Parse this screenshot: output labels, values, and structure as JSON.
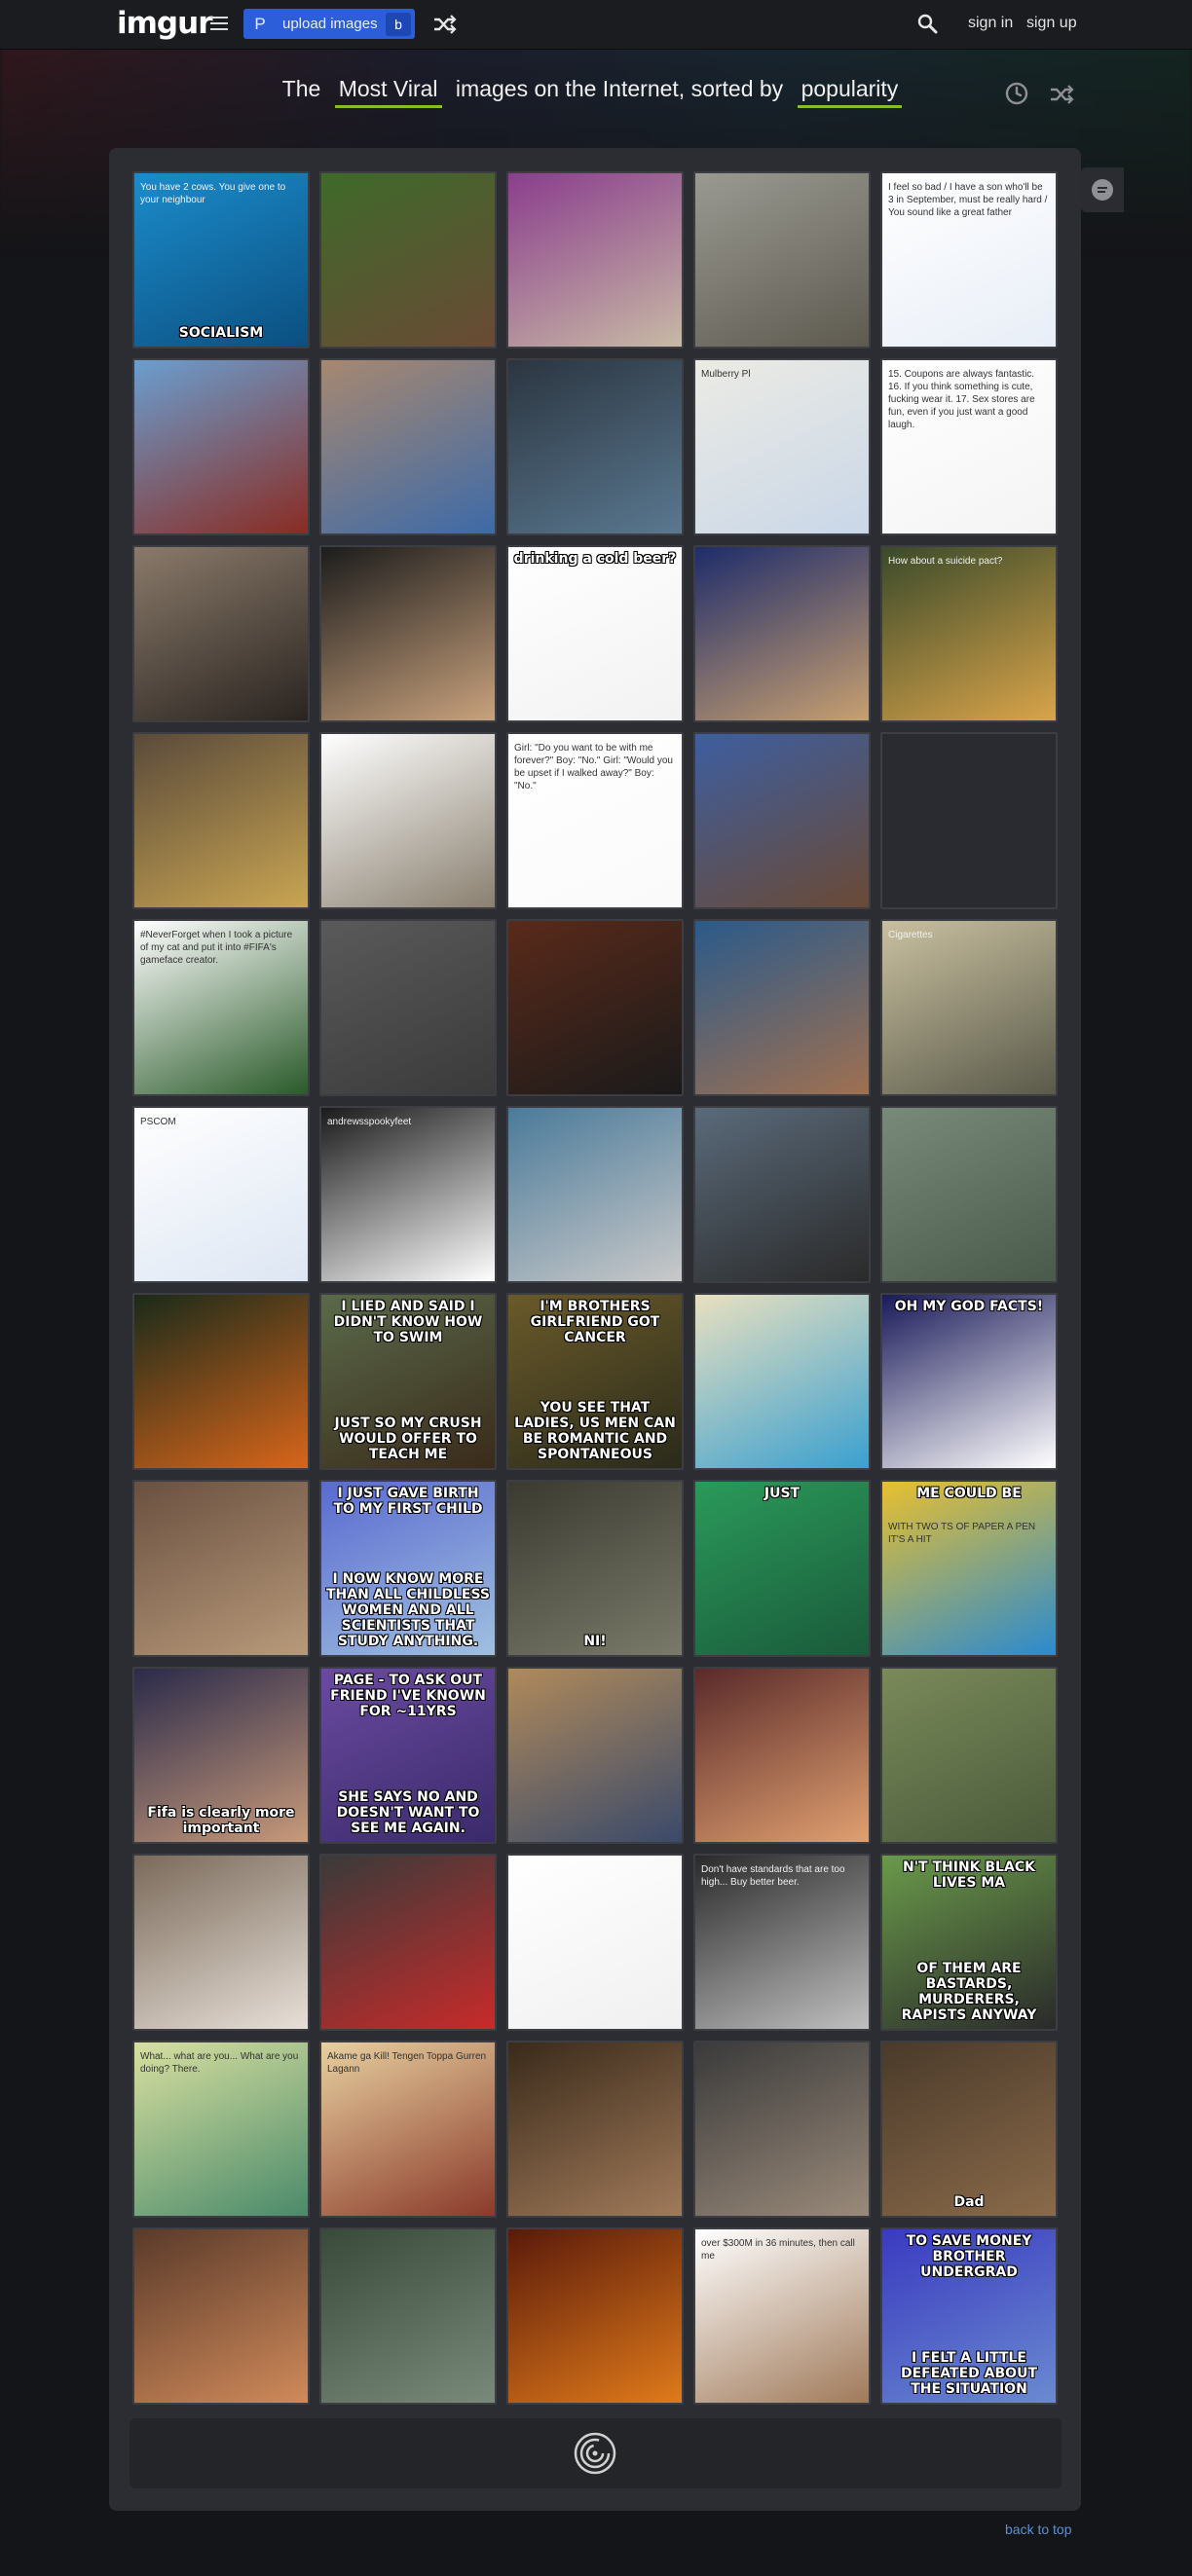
{
  "header": {
    "logo": "imgur",
    "upload_label": "upload images",
    "upload_p": "P",
    "upload_b": "b",
    "sign_in": "sign in",
    "sign_up": "sign up",
    "accent": "#2b5ed8"
  },
  "subtitle": {
    "pre": "The",
    "section": "Most Viral",
    "mid": "images on the Internet, sorted by",
    "sort": "popularity",
    "underline_color": "#85bf25"
  },
  "tiles": [
    {
      "name": "cow-socialism",
      "c1": "#1b8ccb",
      "c2": "#0b4f80",
      "cap_top": "",
      "cap_bot": "SOCIALISM",
      "note": "You have 2 cows. You give one to your neighbour"
    },
    {
      "name": "dog-hammock",
      "c1": "#3e6a2a",
      "c2": "#6a4a35",
      "cap_top": "",
      "cap_bot": "",
      "note": ""
    },
    {
      "name": "skull-flowers",
      "c1": "#8a3d8d",
      "c2": "#c8b9a5",
      "cap_top": "",
      "cap_bot": "",
      "note": ""
    },
    {
      "name": "car-field",
      "c1": "#9a9a92",
      "c2": "#5e5a50",
      "cap_top": "",
      "cap_bot": "",
      "note": ""
    },
    {
      "name": "text-conversation",
      "c1": "#ffffff",
      "c2": "#e8eef7",
      "cap_top": "",
      "cap_bot": "",
      "note": "I feel so bad / I have a son who'll be 3 in September, must be really hard / You sound like a great father"
    },
    {
      "name": "red-house",
      "c1": "#6b9ed0",
      "c2": "#8a2b22",
      "cap_top": "",
      "cap_bot": "",
      "note": ""
    },
    {
      "name": "candy-bowl",
      "c1": "#a78870",
      "c2": "#3d6aa8",
      "cap_top": "",
      "cap_bot": "",
      "note": ""
    },
    {
      "name": "software-screen",
      "c1": "#2b3540",
      "c2": "#5a7890",
      "cap_top": "",
      "cap_bot": "",
      "note": ""
    },
    {
      "name": "map-route",
      "c1": "#ecebe4",
      "c2": "#c9d7e8",
      "cap_top": "",
      "cap_bot": "",
      "note": "Mulberry Pl"
    },
    {
      "name": "list-text",
      "c1": "#ffffff",
      "c2": "#f4f4f4",
      "cap_top": "",
      "cap_bot": "",
      "note": "15. Coupons are always fantastic. 16. If you think something is cute, fucking wear it. 17. Sex stores are fun, even if you just want a good laugh."
    },
    {
      "name": "blender-cup",
      "c1": "#8a7a6a",
      "c2": "#2a2420",
      "cap_top": "",
      "cap_bot": "",
      "note": ""
    },
    {
      "name": "two-people",
      "c1": "#1c1c1c",
      "c2": "#c9a27d",
      "cap_top": "",
      "cap_bot": "",
      "note": ""
    },
    {
      "name": "cold-beer-text",
      "c1": "#ffffff",
      "c2": "#f2f2f2",
      "cap_top": "drinking a cold beer?",
      "cap_bot": "",
      "note": ""
    },
    {
      "name": "performer",
      "c1": "#1e2c6a",
      "c2": "#c8a070",
      "cap_top": "",
      "cap_bot": "",
      "note": ""
    },
    {
      "name": "animation-bee",
      "c1": "#3a4a2a",
      "c2": "#d9a44a",
      "cap_top": "",
      "cap_bot": "",
      "note": "How about a suicide pact?"
    },
    {
      "name": "r2d2-c3po",
      "c1": "#5a4a3a",
      "c2": "#c9a552",
      "cap_top": "",
      "cap_bot": "",
      "note": ""
    },
    {
      "name": "facebook-post",
      "c1": "#ffffff",
      "c2": "#8a8070",
      "cap_top": "",
      "cap_bot": "",
      "note": ""
    },
    {
      "name": "girl-boy-text",
      "c1": "#ffffff",
      "c2": "#fafafa",
      "cap_top": "",
      "cap_bot": "",
      "note": "Girl: \"Do you want to be with me forever?\" Boy: \"No.\" Girl: \"Would you be upset if I walked away?\" Boy: \"No.\""
    },
    {
      "name": "blue-blanket",
      "c1": "#3d5ea0",
      "c2": "#6a4a35",
      "cap_top": "",
      "cap_bot": "",
      "note": ""
    },
    {
      "name": "empty-dark",
      "c1": "#2a2b30",
      "c2": "#2a2b30",
      "cap_top": "",
      "cap_bot": "",
      "note": ""
    },
    {
      "name": "tweet-soccer",
      "c1": "#ffffff",
      "c2": "#2a5a2a",
      "cap_top": "",
      "cap_bot": "",
      "note": "#NeverForget when I took a picture of my cat and put it into #FIFA's gameface creator."
    },
    {
      "name": "homeless-text",
      "c1": "#5a5a5a",
      "c2": "#3a3a3a",
      "cap_top": "",
      "cap_bot": "",
      "note": ""
    },
    {
      "name": "bar-girl",
      "c1": "#5a2a1a",
      "c2": "#1a1a1a",
      "cap_top": "",
      "cap_bot": "",
      "note": ""
    },
    {
      "name": "gym-court",
      "c1": "#2a5a8a",
      "c2": "#a07050",
      "cap_top": "",
      "cap_bot": "",
      "note": ""
    },
    {
      "name": "chain-box",
      "c1": "#c9c0a0",
      "c2": "#5a5a4a",
      "cap_top": "",
      "cap_bot": "",
      "note": "Cigarettes"
    },
    {
      "name": "spreadsheet",
      "c1": "#ffffff",
      "c2": "#dde6f3",
      "cap_top": "",
      "cap_bot": "",
      "note": "PSCOM"
    },
    {
      "name": "concert-post",
      "c1": "#1a1a1a",
      "c2": "#ffffff",
      "cap_top": "",
      "cap_bot": "",
      "note": "andrewsspookyfeet"
    },
    {
      "name": "ocean-boat",
      "c1": "#4a7a9a",
      "c2": "#c9c9c9",
      "cap_top": "",
      "cap_bot": "",
      "note": ""
    },
    {
      "name": "armored-figure",
      "c1": "#5a6a7a",
      "c2": "#2a2a2a",
      "cap_top": "",
      "cap_bot": "",
      "note": ""
    },
    {
      "name": "hulk",
      "c1": "#7a8a7a",
      "c2": "#4a5a4a",
      "cap_top": "",
      "cap_bot": "",
      "note": ""
    },
    {
      "name": "playground-fire",
      "c1": "#1a2a1a",
      "c2": "#d9651a",
      "cap_top": "",
      "cap_bot": "",
      "note": ""
    },
    {
      "name": "confession-bear",
      "c1": "#5a6a4a",
      "c2": "#3a2a1a",
      "cap_top": "I LIED AND SAID I DIDN'T KNOW HOW TO SWIM",
      "cap_bot": "JUST SO MY CRUSH WOULD OFFER TO TEACH ME",
      "note": ""
    },
    {
      "name": "tiger-meme",
      "c1": "#6a5a2a",
      "c2": "#2a2a1a",
      "cap_top": "I'M BROTHERS GIRLFRIEND GOT CANCER",
      "cap_bot": "YOU SEE THAT LADIES, US MEN CAN BE ROMANTIC AND SPONTANEOUS",
      "note": ""
    },
    {
      "name": "cartoon-faces",
      "c1": "#e8e0c0",
      "c2": "#3aa0d0",
      "cap_top": "",
      "cap_bot": "",
      "note": ""
    },
    {
      "name": "god-facts",
      "c1": "#1a1a5a",
      "c2": "#ffffff",
      "cap_top": "OH MY GOD FACTS!",
      "cap_bot": "",
      "note": ""
    },
    {
      "name": "cat-room",
      "c1": "#6a5040",
      "c2": "#b89a7a",
      "cap_top": "",
      "cap_bot": "",
      "note": ""
    },
    {
      "name": "success-kid",
      "c1": "#5a6ad0",
      "c2": "#a0c0e0",
      "cap_top": "I JUST GAVE BIRTH TO MY FIRST CHILD",
      "cap_bot": "I NOW KNOW MORE THAN ALL CHILDLESS WOMEN AND ALL SCIENTISTS THAT STUDY ANYTHING.",
      "note": ""
    },
    {
      "name": "tree-cave",
      "c1": "#3a3a30",
      "c2": "#7a7a6a",
      "cap_top": "",
      "cap_bot": "NI!",
      "note": ""
    },
    {
      "name": "just-do-it",
      "c1": "#2a9a5a",
      "c2": "#1a5a3a",
      "cap_top": "JUST",
      "cap_bot": "",
      "note": ""
    },
    {
      "name": "paper-pen",
      "c1": "#e8c030",
      "c2": "#2a8ad0",
      "cap_top": "ME COULD BE",
      "cap_bot": "",
      "note": "WITH TWO TS OF PAPER A PEN IT'S A HIT"
    },
    {
      "name": "fifa-legs",
      "c1": "#2a2a4a",
      "c2": "#c89a7a",
      "cap_top": "",
      "cap_bot": "Fifa is clearly more important",
      "note": ""
    },
    {
      "name": "bad-luck-brian",
      "c1": "#6a4aa0",
      "c2": "#3a2a6a",
      "cap_top": "PAGE - TO ASK OUT FRIEND I'VE KNOWN FOR ~11YRS",
      "cap_bot": "SHE SAYS NO AND DOESN'T WANT TO SEE ME AGAIN.",
      "note": ""
    },
    {
      "name": "controllers",
      "c1": "#b08a5a",
      "c2": "#3a4a6a",
      "cap_top": "",
      "cap_bot": "",
      "note": ""
    },
    {
      "name": "dancers",
      "c1": "#5a2a2a",
      "c2": "#e0a070",
      "cap_top": "",
      "cap_bot": "",
      "note": ""
    },
    {
      "name": "park-trees",
      "c1": "#7a8a5a",
      "c2": "#4a5a3a",
      "cap_top": "",
      "cap_bot": "",
      "note": ""
    },
    {
      "name": "wedding-dance",
      "c1": "#7a6a5a",
      "c2": "#e8e0d8",
      "cap_top": "",
      "cap_bot": "",
      "note": ""
    },
    {
      "name": "speaker-cartoon",
      "c1": "#3a3a3a",
      "c2": "#c82a2a",
      "cap_top": "",
      "cap_bot": "",
      "note": ""
    },
    {
      "name": "rubiks-text",
      "c1": "#ffffff",
      "c2": "#f0f0f0",
      "cap_top": "",
      "cap_bot": "",
      "note": ""
    },
    {
      "name": "quote-man",
      "c1": "#2a2a2a",
      "c2": "#c0c0c0",
      "cap_top": "",
      "cap_bot": "",
      "note": "Don't have standards that are too high... Buy better beer."
    },
    {
      "name": "puffin",
      "c1": "#6a9a4a",
      "c2": "#2a2a2a",
      "cap_top": "N'T THINK BLACK LIVES MA",
      "cap_bot": "OF THEM ARE BASTARDS, MURDERERS, RAPISTS ANYWAY",
      "note": ""
    },
    {
      "name": "comic-hug",
      "c1": "#d8e0a0",
      "c2": "#4a8a6a",
      "cap_top": "",
      "cap_bot": "",
      "note": "What... what are you... What are you doing? There."
    },
    {
      "name": "poster-text",
      "c1": "#e8d0a0",
      "c2": "#8a3a2a",
      "cap_top": "",
      "cap_bot": "",
      "note": "Akame ga Kill! Tengen Toppa Gurren Lagann"
    },
    {
      "name": "cat-woman",
      "c1": "#3a2a1a",
      "c2": "#a07a5a",
      "cap_top": "",
      "cap_bot": "",
      "note": ""
    },
    {
      "name": "woman-hair",
      "c1": "#3a3a3a",
      "c2": "#9a8a7a",
      "cap_top": "",
      "cap_bot": "",
      "note": ""
    },
    {
      "name": "dad-boy",
      "c1": "#4a3a2a",
      "c2": "#8a6a4a",
      "cap_top": "",
      "cap_bot": "Dad",
      "note": ""
    },
    {
      "name": "redhead",
      "c1": "#5a3a2a",
      "c2": "#d08a5a",
      "cap_top": "",
      "cap_bot": "",
      "note": ""
    },
    {
      "name": "wreck-rocks",
      "c1": "#3a4a3a",
      "c2": "#7a8a7a",
      "cap_top": "",
      "cap_bot": "",
      "note": ""
    },
    {
      "name": "fire-balrog",
      "c1": "#5a1a0a",
      "c2": "#e07a1a",
      "cap_top": "",
      "cap_bot": "",
      "note": ""
    },
    {
      "name": "fighters",
      "c1": "#ffffff",
      "c2": "#a07a5a",
      "cap_top": "",
      "cap_bot": "",
      "note": "over $300M in 36 minutes, then call me"
    },
    {
      "name": "baby-meme",
      "c1": "#3a3ac0",
      "c2": "#6a8ad0",
      "cap_top": "TO SAVE MONEY BROTHER UNDERGRAD",
      "cap_bot": "I FELT A LITTLE DEFEATED ABOUT THE SITUATION",
      "note": ""
    }
  ],
  "footer": {
    "back_to_top": "back to top"
  }
}
